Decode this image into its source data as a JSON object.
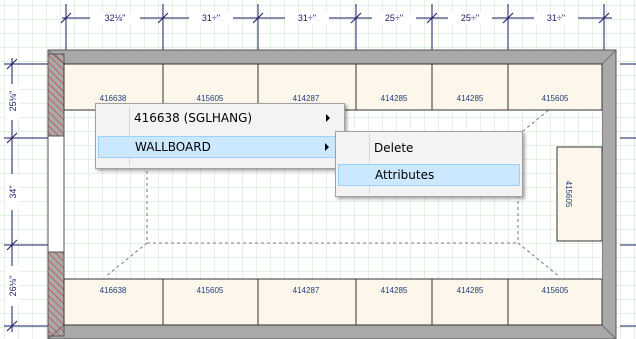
{
  "dimensions": {
    "top": [
      "32⅛\"",
      "31÷\"",
      "31÷\"",
      "25÷\"",
      "25÷\"",
      "31÷\""
    ],
    "left": [
      "25⅛\"",
      "34\"",
      "26⅛\""
    ]
  },
  "panels": {
    "top": [
      "416638",
      "415605",
      "414287",
      "414285",
      "414285",
      "415605"
    ],
    "bottom": [
      "416638",
      "415605",
      "414287",
      "414285",
      "414285",
      "415605"
    ],
    "right": "415605"
  },
  "context_menu": {
    "item1": "416638 (SGLHANG)",
    "item2": "WALLBOARD"
  },
  "submenu": {
    "delete": "Delete",
    "attributes": "Attributes"
  },
  "colors": {
    "grid": "#c9e6c9",
    "wall": "#a9a9a9",
    "panel_fill": "#fcf7ea",
    "hatch": "#d42b2b",
    "highlight": "#cce8ff"
  }
}
